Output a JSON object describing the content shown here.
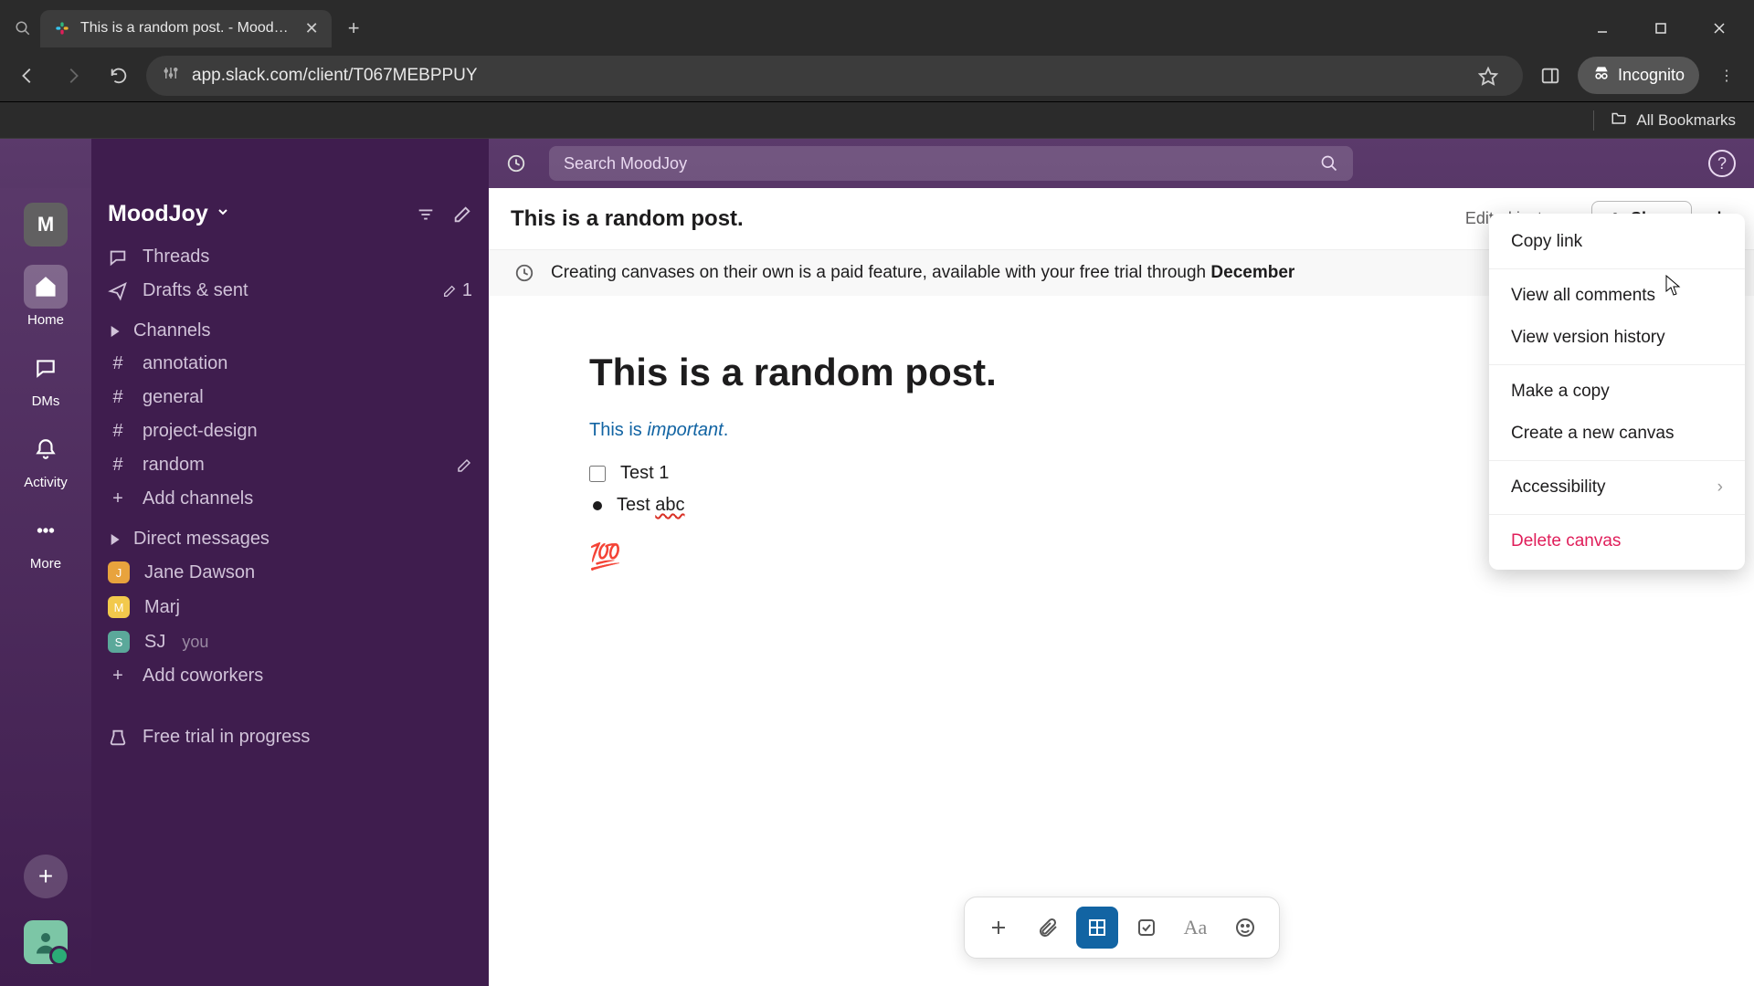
{
  "browser": {
    "tab_title": "This is a random post. - Mood…",
    "url": "app.slack.com/client/T067MEBPPUY",
    "incognito_label": "Incognito",
    "all_bookmarks": "All Bookmarks"
  },
  "slack_top": {
    "search_placeholder": "Search MoodJoy"
  },
  "rail": {
    "avatar_letter": "M",
    "home": "Home",
    "dms": "DMs",
    "activity": "Activity",
    "more": "More"
  },
  "sidebar": {
    "workspace": "MoodJoy",
    "threads": "Threads",
    "drafts": "Drafts & sent",
    "drafts_count": "1",
    "channels_header": "Channels",
    "channels": [
      "annotation",
      "general",
      "project-design",
      "random"
    ],
    "add_channels": "Add channels",
    "dms_header": "Direct messages",
    "dms": [
      {
        "name": "Jane Dawson"
      },
      {
        "name": "Marj"
      },
      {
        "name": "SJ",
        "suffix": "you"
      }
    ],
    "add_coworkers": "Add coworkers",
    "trial": "Free trial in progress"
  },
  "canvas": {
    "header_title": "This is a random post.",
    "edited": "Edited just now",
    "share": "Share",
    "banner_text_pre": "Creating canvases on their own is a paid feature, available with your free trial through ",
    "banner_bold": "December",
    "doc_title": "This is a random post.",
    "line_prefix": "This is ",
    "line_italic": "important",
    "line_suffix": ".",
    "check_item": "Test 1",
    "bullet_prefix": "Test ",
    "bullet_spell": "abc",
    "emoji": "💯"
  },
  "context_menu": {
    "copy_link": "Copy link",
    "view_comments": "View all comments",
    "version_history": "View version history",
    "make_copy": "Make a copy",
    "new_canvas": "Create a new canvas",
    "accessibility": "Accessibility",
    "delete": "Delete canvas"
  }
}
